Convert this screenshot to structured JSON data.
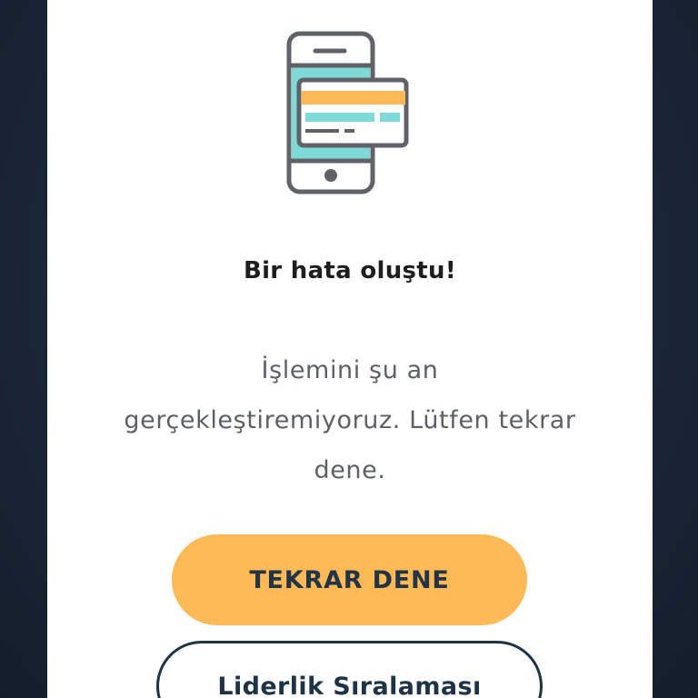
{
  "error_dialog": {
    "illustration_icon": "phone-payment-card-icon",
    "title": "Bir hata oluştu!",
    "message": "İşlemini şu an gerçekleştiremiyoruz. Lütfen tekrar dene.",
    "retry_button_label": "TEKRAR DENE",
    "leaderboard_button_label": "Liderlik Sıralaması"
  },
  "colors": {
    "accent": "#ffb957",
    "dark_text": "#243447",
    "screen_cyan": "#7fd9d6",
    "icon_outline": "#5f6368",
    "backdrop": "#1b2638"
  }
}
